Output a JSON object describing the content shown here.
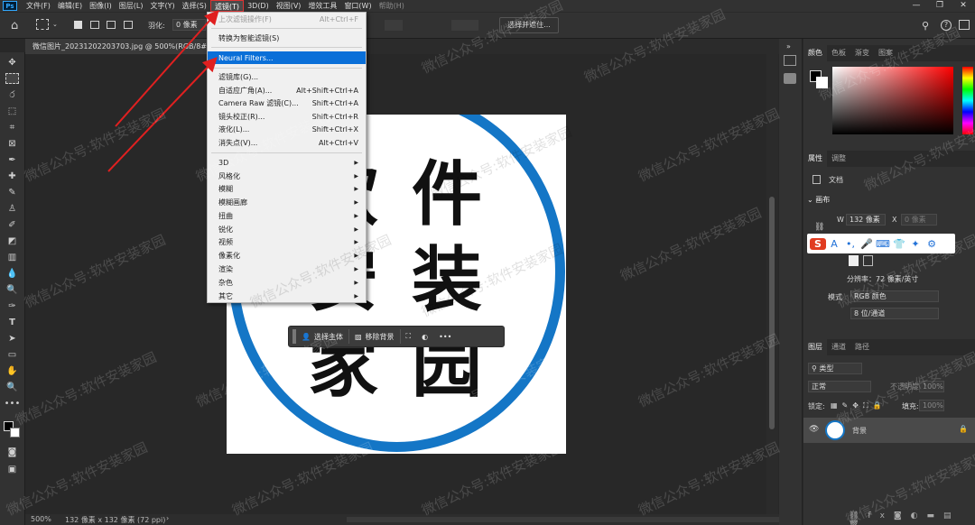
{
  "app": {
    "logo": "Ps"
  },
  "menubar": {
    "items": [
      "文件(F)",
      "编辑(E)",
      "图像(I)",
      "图层(L)",
      "文字(Y)",
      "选择(S)",
      "滤镜(T)",
      "3D(D)",
      "视图(V)",
      "增效工具",
      "窗口(W)",
      "帮助(H)"
    ],
    "active_index": 6,
    "window_controls": [
      "—",
      "❐",
      "✕"
    ]
  },
  "options": {
    "feather_label": "羽化:",
    "feather_value": "0 像素",
    "select_mask_button": "选择并遮住..."
  },
  "document": {
    "tab_title": "微信图片_20231202203703.jpg @ 500%(RGB/8#)",
    "glyphs": [
      "软",
      "件",
      "安",
      "装",
      "家",
      "园"
    ]
  },
  "filter_menu": {
    "items": [
      {
        "label": "上次滤镜操作(F)",
        "shortcut": "Alt+Ctrl+F",
        "disabled": true
      },
      {
        "label": "转换为智能滤镜(S)",
        "shortcut": ""
      },
      {
        "label": "Neural Filters...",
        "shortcut": "",
        "highlighted": true
      },
      {
        "label": "滤镜库(G)...",
        "shortcut": ""
      },
      {
        "label": "自适应广角(A)...",
        "shortcut": "Alt+Shift+Ctrl+A"
      },
      {
        "label": "Camera Raw 滤镜(C)...",
        "shortcut": "Shift+Ctrl+A"
      },
      {
        "label": "镜头校正(R)...",
        "shortcut": "Shift+Ctrl+R"
      },
      {
        "label": "液化(L)...",
        "shortcut": "Shift+Ctrl+X"
      },
      {
        "label": "消失点(V)...",
        "shortcut": "Alt+Ctrl+V"
      },
      {
        "label": "3D",
        "submenu": true
      },
      {
        "label": "风格化",
        "submenu": true
      },
      {
        "label": "模糊",
        "submenu": true
      },
      {
        "label": "模糊画廊",
        "submenu": true
      },
      {
        "label": "扭曲",
        "submenu": true
      },
      {
        "label": "锐化",
        "submenu": true
      },
      {
        "label": "视频",
        "submenu": true
      },
      {
        "label": "像素化",
        "submenu": true
      },
      {
        "label": "渲染",
        "submenu": true
      },
      {
        "label": "杂色",
        "submenu": true
      },
      {
        "label": "其它",
        "submenu": true
      }
    ]
  },
  "context_bar": {
    "select_subject": "选择主体",
    "remove_bg": "移除背景",
    "more": "•••"
  },
  "status": {
    "zoom": "500%",
    "doc_size": "132 像素 x 132 像素 (72 ppi)"
  },
  "panels": {
    "color_tabs": [
      "颜色",
      "色板",
      "渐变",
      "图案"
    ],
    "props_tabs": [
      "属性",
      "调整"
    ],
    "doc_label": "文档",
    "canvas_section": "画布",
    "width_label": "W",
    "width_value": "132 像素",
    "x_label": "X",
    "x_value": "0 像素",
    "resolution": "分辨率：72 像素/英寸",
    "mode_label": "模式",
    "mode_value": "RGB 颜色",
    "depth_value": "8 位/通道",
    "layers_tabs": [
      "图层",
      "通道",
      "路径"
    ],
    "layer_kind": "类型",
    "blend_mode": "正常",
    "opacity_label": "不透明度:",
    "opacity_value": "100%",
    "lock_label": "锁定:",
    "fill_label": "填充:",
    "fill_value": "100%",
    "layer_name": "背景"
  },
  "ime": {
    "logo": "S",
    "icons": [
      "A",
      "•,",
      "🎤",
      "⌨",
      "👕",
      "✦",
      "⚙"
    ]
  },
  "watermark": "微信公众号:软件安装家园",
  "colors": {
    "accent": "#0a6fd8",
    "ring": "#1476c6",
    "annotation": "#e02020"
  }
}
